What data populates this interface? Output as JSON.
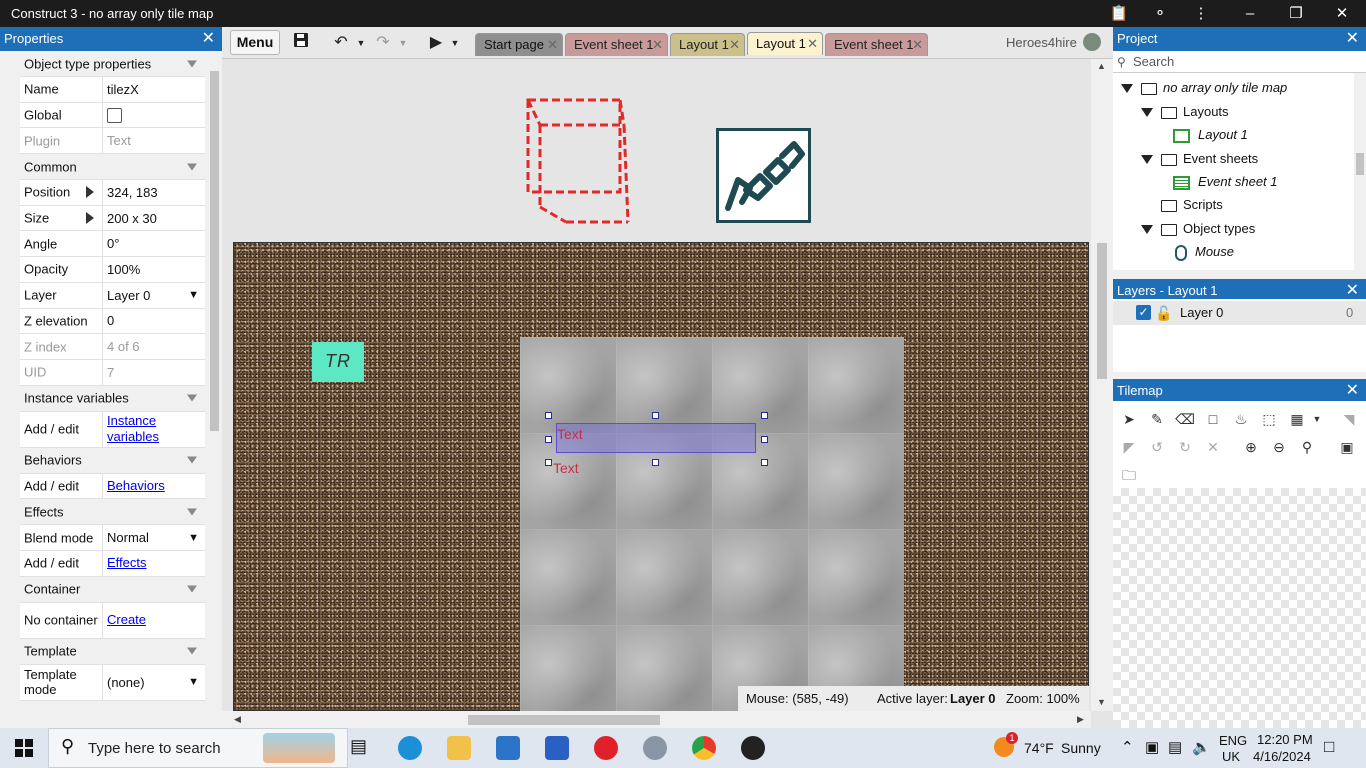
{
  "window": {
    "title": "Construct 3 - no array only tile map"
  },
  "properties": {
    "title": "Properties",
    "rows": [
      {
        "type": "section",
        "label": "Object type properties"
      },
      {
        "type": "text",
        "label": "Name",
        "value": "tilezX"
      },
      {
        "type": "check",
        "label": "Global",
        "checked": false
      },
      {
        "type": "text",
        "label": "Plugin",
        "value": "Text",
        "disabled": true
      },
      {
        "type": "section",
        "label": "Common"
      },
      {
        "type": "expand",
        "label": "Position",
        "value": "324, 183"
      },
      {
        "type": "expand",
        "label": "Size",
        "value": "200 x 30"
      },
      {
        "type": "text",
        "label": "Angle",
        "value": "0°"
      },
      {
        "type": "text",
        "label": "Opacity",
        "value": "100%"
      },
      {
        "type": "select",
        "label": "Layer",
        "value": "Layer 0"
      },
      {
        "type": "text",
        "label": "Z elevation",
        "value": "0"
      },
      {
        "type": "text",
        "label": "Z index",
        "value": "4 of 6",
        "disabled": true
      },
      {
        "type": "text",
        "label": "UID",
        "value": "7",
        "disabled": true
      },
      {
        "type": "section",
        "label": "Instance variables"
      },
      {
        "type": "link",
        "label": "Add / edit",
        "value": "Instance variables",
        "tall": true
      },
      {
        "type": "section",
        "label": "Behaviors"
      },
      {
        "type": "link",
        "label": "Add / edit",
        "value": "Behaviors"
      },
      {
        "type": "section",
        "label": "Effects"
      },
      {
        "type": "select",
        "label": "Blend mode",
        "value": "Normal"
      },
      {
        "type": "link",
        "label": "Add / edit",
        "value": "Effects"
      },
      {
        "type": "section",
        "label": "Container"
      },
      {
        "type": "link",
        "label": "No container",
        "value": "Create",
        "tall": true
      },
      {
        "type": "section",
        "label": "Template"
      },
      {
        "type": "select",
        "label": "Template mode",
        "value": "(none)",
        "tall": true
      }
    ]
  },
  "toolbar": {
    "menu_label": "Menu",
    "user": "Heroes4hire",
    "tabs": [
      {
        "label": "Start page",
        "bg": "#8f8f8f",
        "color": "#111"
      },
      {
        "label": "Event sheet 1",
        "bg": "#c99a9a",
        "color": "#222"
      },
      {
        "label": "Layout 1",
        "bg": "#cbc08a",
        "color": "#222"
      },
      {
        "label": "Layout 1",
        "bg": "#fbf3cf",
        "color": "#111",
        "active": true
      },
      {
        "label": "Event sheet 1",
        "bg": "#c99a9a",
        "color": "#222"
      }
    ]
  },
  "layout": {
    "sprite_text": "TR",
    "text_instance_1": "Text",
    "text_instance_2": "Text",
    "status": {
      "mouse": "Mouse: (585, -49)",
      "active_layer_label": "Active layer:",
      "active_layer_value": "Layer 0",
      "zoom": "Zoom: 100%"
    }
  },
  "project": {
    "title": "Project",
    "search_placeholder": "Search",
    "tree": [
      {
        "label": "no array only tile map",
        "indent": 0,
        "kind": "folder",
        "expanded": true,
        "italic": true
      },
      {
        "label": "Layouts",
        "indent": 1,
        "kind": "folder",
        "expanded": true
      },
      {
        "label": "Layout 1",
        "indent": 2,
        "kind": "layout",
        "italic": true
      },
      {
        "label": "Event sheets",
        "indent": 1,
        "kind": "folder",
        "expanded": true
      },
      {
        "label": "Event sheet 1",
        "indent": 2,
        "kind": "eventsheet",
        "italic": true
      },
      {
        "label": "Scripts",
        "indent": 1,
        "kind": "folder"
      },
      {
        "label": "Object types",
        "indent": 1,
        "kind": "folder",
        "expanded": true
      },
      {
        "label": "Mouse",
        "indent": 2,
        "kind": "mouse",
        "italic": true
      }
    ]
  },
  "layers": {
    "title": "Layers - Layout 1",
    "items": [
      {
        "name": "Layer 0",
        "count": "0",
        "visible": true
      }
    ]
  },
  "tilemap_panel": {
    "title": "Tilemap"
  },
  "taskbar": {
    "search_placeholder": "Type here to search",
    "weather_temp": "74°F",
    "weather_text": "Sunny",
    "lang_1": "ENG",
    "lang_2": "UK",
    "time": "12:20 PM",
    "date": "4/16/2024",
    "notification_count": "1"
  },
  "colors": {
    "accent": "#1e6fb8",
    "selection": "#5a4fd0",
    "text_instance": "#c0334a"
  }
}
